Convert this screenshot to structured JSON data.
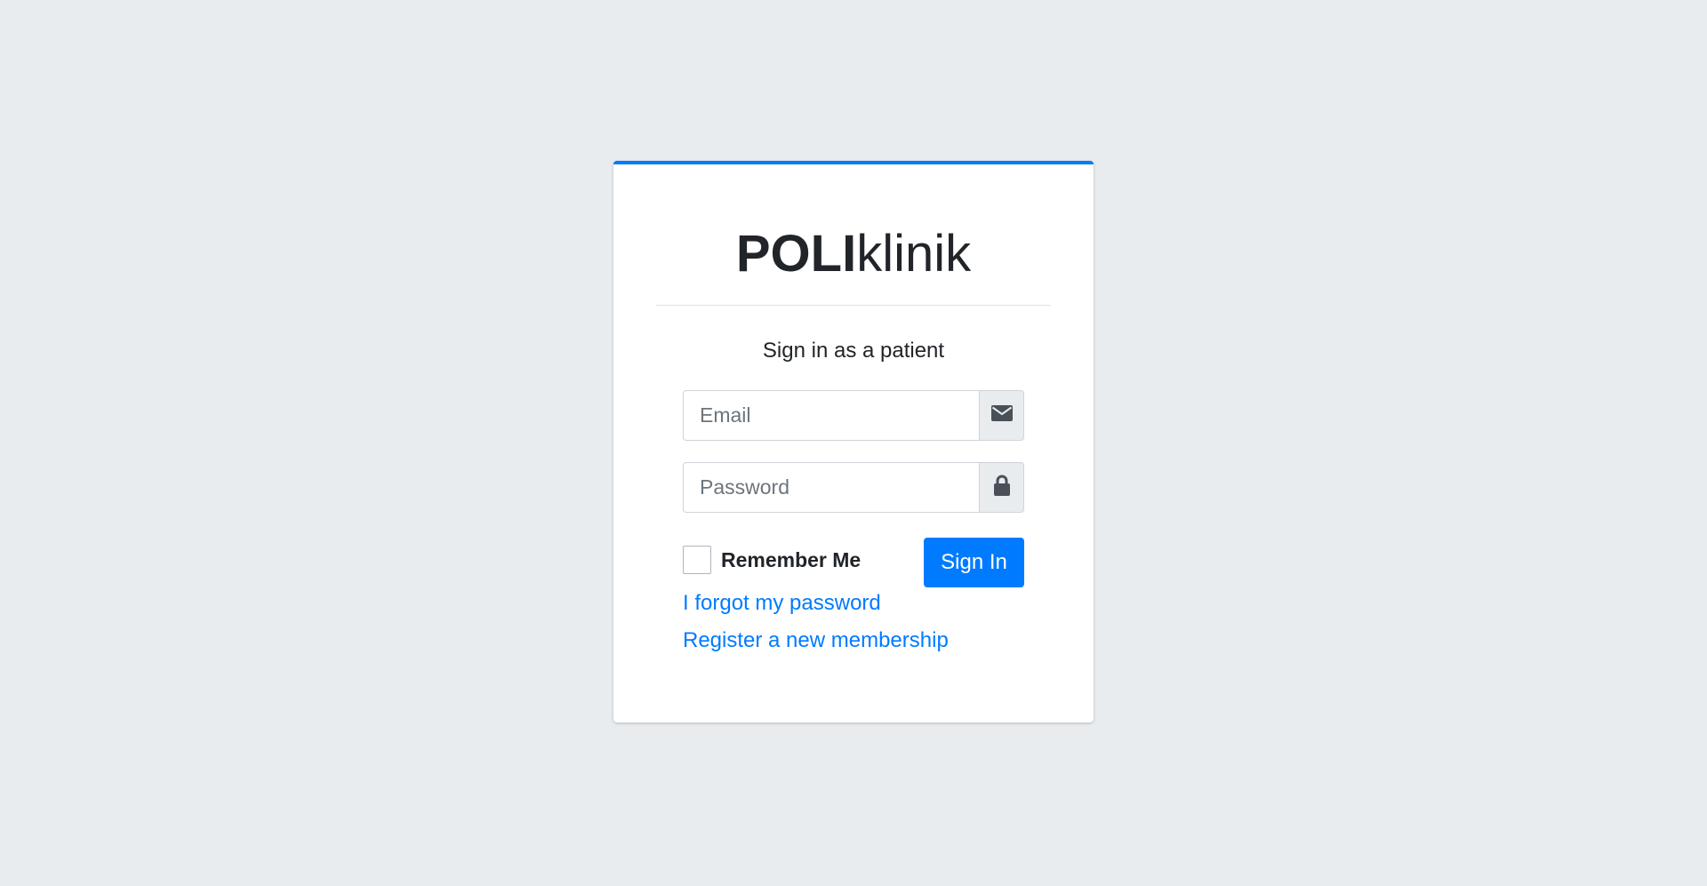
{
  "brand": {
    "bold": "POLI",
    "light": "klinik"
  },
  "subtitle": "Sign in as a patient",
  "form": {
    "email": {
      "placeholder": "Email",
      "value": "",
      "icon": "envelope-icon"
    },
    "password": {
      "placeholder": "Password",
      "value": "",
      "icon": "lock-icon"
    },
    "remember_label": "Remember Me",
    "remember_checked": false,
    "submit_label": "Sign In"
  },
  "links": {
    "forgot": "I forgot my password",
    "register": "Register a new membership"
  },
  "colors": {
    "primary": "#007bff",
    "background": "#e9ecef",
    "text": "#212529",
    "addon_icon": "#495057"
  }
}
